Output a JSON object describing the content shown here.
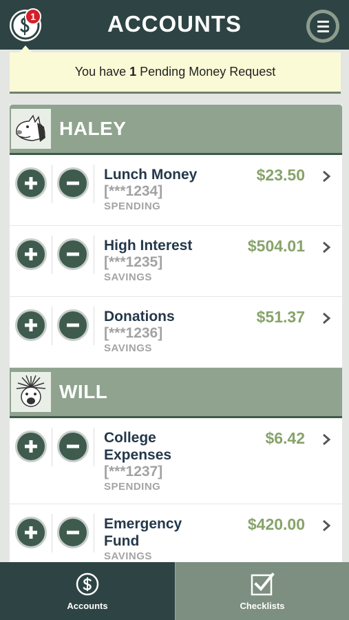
{
  "header": {
    "title": "ACCOUNTS",
    "notification_count": "1",
    "logo_icon": "money-request-icon",
    "menu_icon": "hamburger-menu-icon"
  },
  "pending_banner": {
    "prefix": "You have",
    "count": "1",
    "suffix": "Pending Money Request"
  },
  "members": [
    {
      "name": "HALEY",
      "avatar_icon": "donkey-avatar-icon",
      "accounts": [
        {
          "name": "Lunch Money",
          "mask": "[***1234]",
          "type": "SPENDING",
          "amount": "$23.50"
        },
        {
          "name": "High Interest",
          "mask": "[***1235]",
          "type": "SAVINGS",
          "amount": "$504.01"
        },
        {
          "name": "Donations",
          "mask": "[***1236]",
          "type": "SAVINGS",
          "amount": "$51.37"
        }
      ]
    },
    {
      "name": "WILL",
      "avatar_icon": "porcupine-avatar-icon",
      "accounts": [
        {
          "name": "College Expenses",
          "mask": "[***1237]",
          "type": "SPENDING",
          "amount": "$6.42"
        },
        {
          "name": "Emergency Fund",
          "mask": "",
          "type": "SAVINGS",
          "amount": "$420.00"
        }
      ]
    }
  ],
  "bottom_nav": {
    "accounts_label": "Accounts",
    "checklists_label": "Checklists"
  },
  "colors": {
    "header_bg": "#2e4444",
    "section_bg": "#8fa38f",
    "amount": "#87a36a",
    "account_name": "#24384a",
    "badge": "#d31f2a",
    "banner_bg": "#fafad6"
  }
}
